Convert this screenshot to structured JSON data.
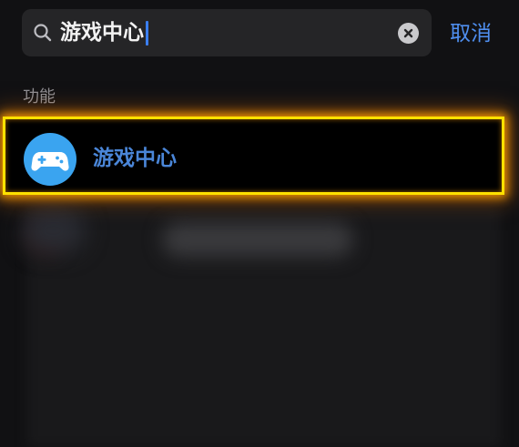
{
  "search": {
    "query": "游戏中心",
    "cancel_label": "取消"
  },
  "section": {
    "title": "功能"
  },
  "results": [
    {
      "label": "游戏中心",
      "icon": "gamepad-icon"
    }
  ],
  "colors": {
    "accent": "#4f8ff0",
    "highlight": "#ffe100",
    "app_icon_bg": "#3aa4f0"
  }
}
